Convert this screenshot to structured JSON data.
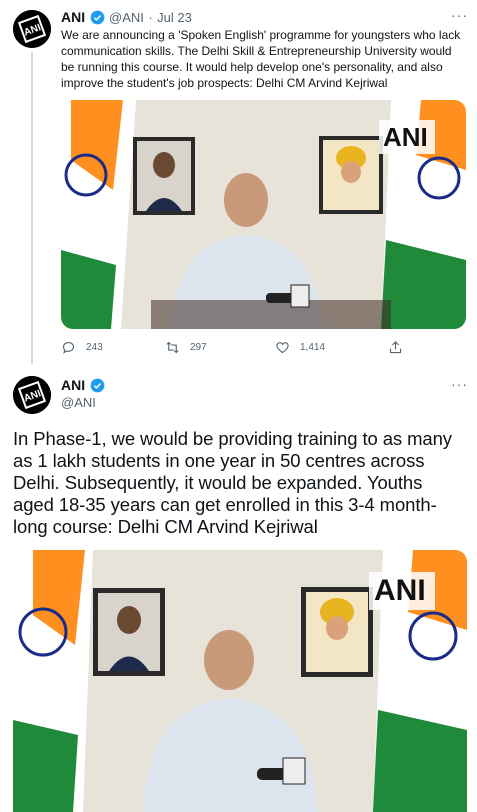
{
  "tweet1": {
    "author_name": "ANI",
    "author_handle": "@ANI",
    "separator": "·",
    "date": "Jul 23",
    "text": "We are announcing a 'Spoken English' programme for youngsters who lack communication skills. The Delhi Skill & Entrepreneurship University would be running this course. It would help develop one's personality, and also improve the student's job prospects: Delhi CM Arvind Kejriwal",
    "media_watermark": "ANI",
    "replies": "243",
    "retweets": "297",
    "likes": "1,414"
  },
  "tweet2": {
    "author_name": "ANI",
    "author_handle": "@ANI",
    "text": "In Phase-1, we would be providing training to as many as 1 lakh students in one year in 50 centres across Delhi. Subsequently, it would be expanded. Youths aged 18-35 years can get enrolled in this 3-4 month-long course: Delhi CM Arvind Kejriwal",
    "media_watermark": "ANI"
  },
  "avatar_text": "ANI",
  "icons": {
    "verified": "verified-badge-icon",
    "more": "more-options-icon",
    "reply": "reply-icon",
    "retweet": "retweet-icon",
    "like": "like-icon",
    "share": "share-icon"
  },
  "colors": {
    "verified_blue": "#1d9bf0",
    "text_secondary": "#536471",
    "saffron": "#ff8f1f",
    "flag_green": "#1f8a3a"
  }
}
